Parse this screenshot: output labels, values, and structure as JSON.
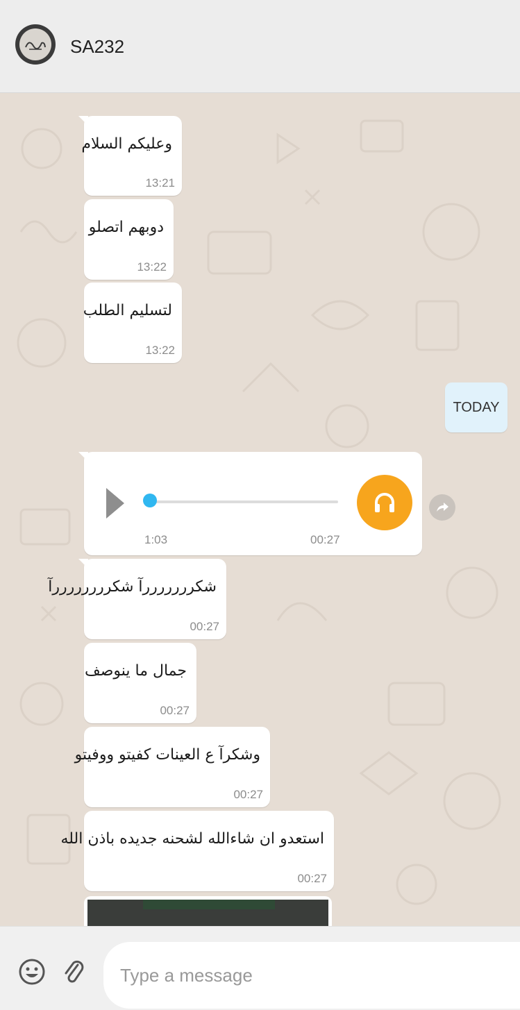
{
  "header": {
    "contact_name": "SA232",
    "avatar_icon": "calligraphy-avatar"
  },
  "messages": [
    {
      "text": "وعليكم السلام",
      "time": "13:21"
    },
    {
      "text": "دوبهم اتصلو",
      "time": "13:22"
    },
    {
      "text": "لتسليم الطلب",
      "time": "13:22"
    }
  ],
  "date_divider": "TODAY",
  "audio_message": {
    "duration": "1:03",
    "time": "00:27",
    "progress": 0.0,
    "accent_color": "#f7a51d",
    "knob_color": "#30b7f0"
  },
  "messages_today": [
    {
      "text": "شكرررررررآ شكررررررررآ",
      "time": "00:27"
    },
    {
      "text": "جمال ما ينوصف",
      "time": "00:27"
    },
    {
      "text": "وشكرآ ع العينات كفيتو ووفيتو",
      "time": "00:27"
    },
    {
      "text": "استعدو ان شاءالله لشحنه جديده باذن الله",
      "time": "00:27"
    }
  ],
  "composer": {
    "placeholder": "Type a message",
    "emoji_icon": "smiley-icon",
    "attach_icon": "paperclip-icon"
  }
}
